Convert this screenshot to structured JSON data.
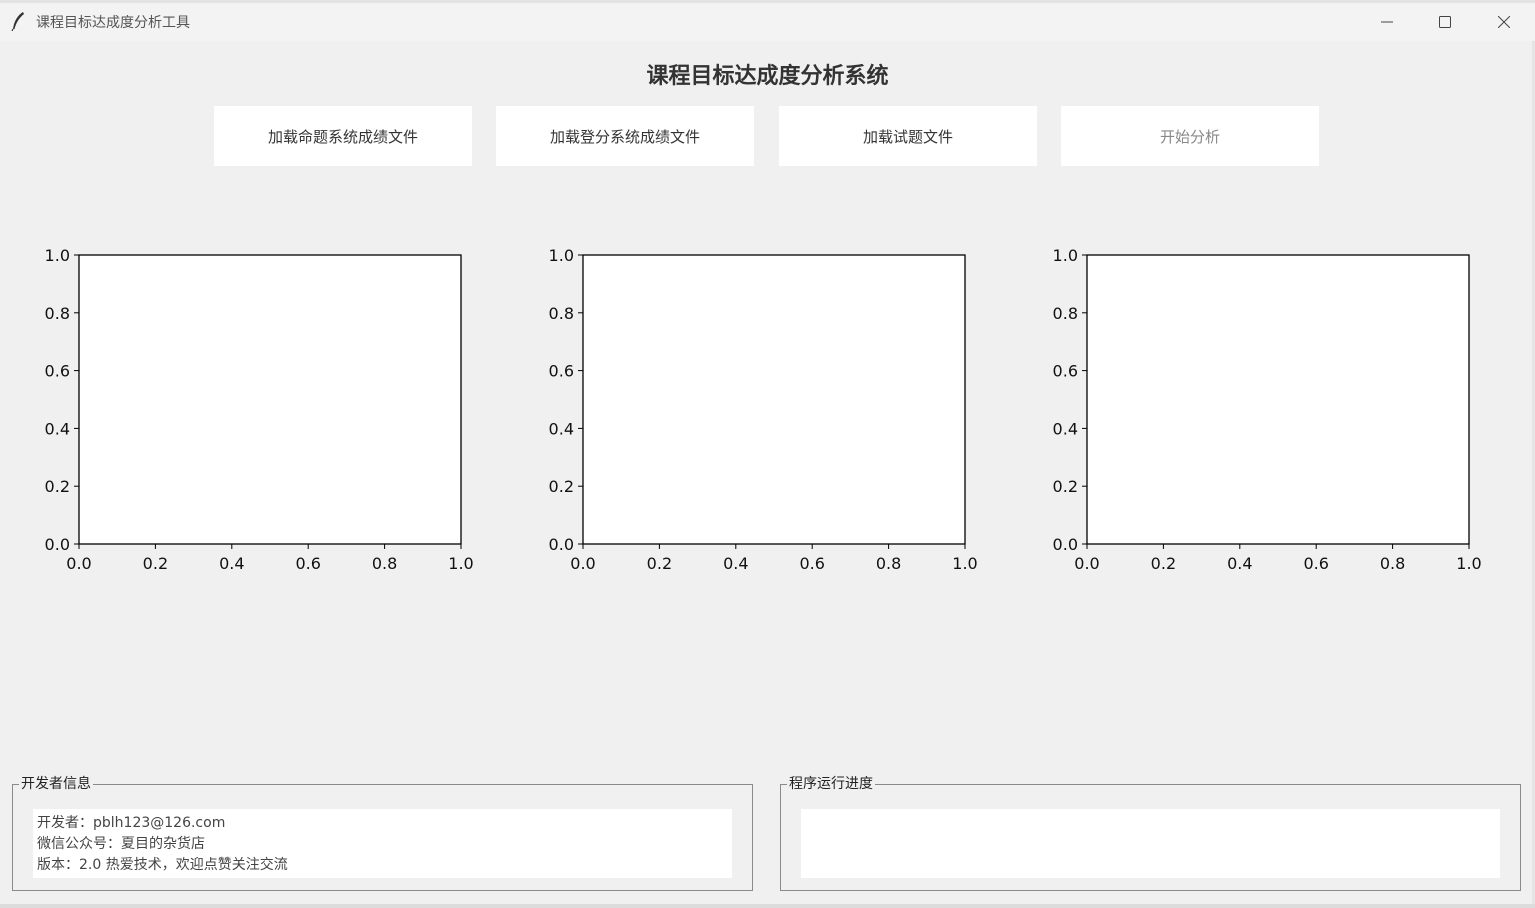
{
  "window": {
    "title": "课程目标达成度分析工具",
    "minimize_icon": "minimize-icon",
    "maximize_icon": "maximize-icon",
    "close_icon": "close-icon",
    "app_icon": "feather-icon"
  },
  "header": {
    "title": "课程目标达成度分析系统"
  },
  "toolbar": {
    "buttons": [
      {
        "label": "加载命题系统成绩文件",
        "enabled": true
      },
      {
        "label": "加载登分系统成绩文件",
        "enabled": true
      },
      {
        "label": "加载试题文件",
        "enabled": true
      },
      {
        "label": "开始分析",
        "enabled": false
      }
    ]
  },
  "chart_data": [
    {
      "type": "line",
      "title": "",
      "xlabel": "",
      "ylabel": "",
      "xlim": [
        0.0,
        1.0
      ],
      "ylim": [
        0.0,
        1.0
      ],
      "xticks": [
        "0.0",
        "0.2",
        "0.4",
        "0.6",
        "0.8",
        "1.0"
      ],
      "yticks": [
        "0.0",
        "0.2",
        "0.4",
        "0.6",
        "0.8",
        "1.0"
      ],
      "series": [],
      "grid": false
    },
    {
      "type": "line",
      "title": "",
      "xlabel": "",
      "ylabel": "",
      "xlim": [
        0.0,
        1.0
      ],
      "ylim": [
        0.0,
        1.0
      ],
      "xticks": [
        "0.0",
        "0.2",
        "0.4",
        "0.6",
        "0.8",
        "1.0"
      ],
      "yticks": [
        "0.0",
        "0.2",
        "0.4",
        "0.6",
        "0.8",
        "1.0"
      ],
      "series": [],
      "grid": false
    },
    {
      "type": "line",
      "title": "",
      "xlabel": "",
      "ylabel": "",
      "xlim": [
        0.0,
        1.0
      ],
      "ylim": [
        0.0,
        1.0
      ],
      "xticks": [
        "0.0",
        "0.2",
        "0.4",
        "0.6",
        "0.8",
        "1.0"
      ],
      "yticks": [
        "0.0",
        "0.2",
        "0.4",
        "0.6",
        "0.8",
        "1.0"
      ],
      "series": [],
      "grid": false
    }
  ],
  "developer_info": {
    "label": "开发者信息",
    "lines": [
      "开发者：pblh123@126.com",
      "微信公众号：夏目的杂货店",
      "版本：2.0 热爱技术，欢迎点赞关注交流"
    ]
  },
  "progress": {
    "label": "程序运行进度",
    "text": ""
  }
}
